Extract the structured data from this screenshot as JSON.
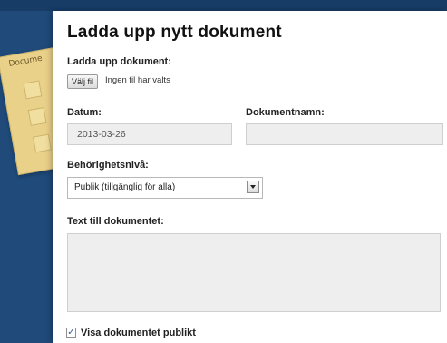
{
  "background_decor": {
    "folder_label": "Docume"
  },
  "dialog": {
    "title": "Ladda upp nytt dokument",
    "upload_label": "Ladda upp dokument:",
    "choose_file_button": "Välj fil",
    "file_status": "Ingen fil har valts",
    "date_label": "Datum:",
    "date_value": "2013-03-26",
    "document_name_label": "Dokumentnamn:",
    "document_name_value": "",
    "permission_label": "Behörighetsnivå:",
    "permission_selected": "Publik (tillgänglig för alla)",
    "text_label": "Text till dokumentet:",
    "text_value": "",
    "show_publicly_label": "Visa dokumentet publikt",
    "show_publicly_checked": true
  },
  "colors": {
    "background": "#1f4a7a",
    "panel": "#ffffff",
    "input_fill": "#eeeeee",
    "folder": "#e9d18a"
  }
}
